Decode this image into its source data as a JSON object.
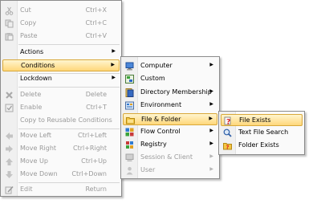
{
  "main_menu": {
    "items": [
      {
        "label": "Cut",
        "shortcut": "Ctrl+X",
        "icon": "cut-icon",
        "enabled": false
      },
      {
        "label": "Copy",
        "shortcut": "Ctrl+C",
        "icon": "copy-icon",
        "enabled": false
      },
      {
        "label": "Paste",
        "shortcut": "Ctrl+V",
        "icon": "paste-icon",
        "enabled": false
      },
      {
        "label": "Actions",
        "submenu": true,
        "enabled": true
      },
      {
        "label": "Conditions",
        "submenu": true,
        "enabled": true,
        "highlighted": true
      },
      {
        "label": "Lockdown",
        "submenu": true,
        "enabled": true
      },
      {
        "label": "Delete",
        "shortcut": "Delete",
        "icon": "delete-icon",
        "enabled": false
      },
      {
        "label": "Enable",
        "shortcut": "Ctrl+T",
        "icon": "enable-icon",
        "enabled": false
      },
      {
        "label": "Copy to Reusable Conditions",
        "enabled": false
      },
      {
        "label": "Move Left",
        "shortcut": "Ctrl+Left",
        "icon": "move-left-icon",
        "enabled": false
      },
      {
        "label": "Move Right",
        "shortcut": "Ctrl+Right",
        "icon": "move-right-icon",
        "enabled": false
      },
      {
        "label": "Move Up",
        "shortcut": "Ctrl+Up",
        "icon": "move-up-icon",
        "enabled": false
      },
      {
        "label": "Move Down",
        "shortcut": "Ctrl+Down",
        "icon": "move-down-icon",
        "enabled": false
      },
      {
        "label": "Edit",
        "shortcut": "Return",
        "icon": "edit-icon",
        "enabled": false
      }
    ]
  },
  "conditions_menu": {
    "items": [
      {
        "label": "Computer",
        "icon": "computer-icon",
        "submenu": true,
        "enabled": true
      },
      {
        "label": "Custom",
        "icon": "custom-icon",
        "submenu": false,
        "enabled": true
      },
      {
        "label": "Directory Membership",
        "icon": "directory-icon",
        "submenu": true,
        "enabled": true
      },
      {
        "label": "Environment",
        "icon": "environment-icon",
        "submenu": true,
        "enabled": true
      },
      {
        "label": "File & Folder",
        "icon": "folder-icon",
        "submenu": true,
        "enabled": true,
        "highlighted": true
      },
      {
        "label": "Flow Control",
        "icon": "flow-control-icon",
        "submenu": true,
        "enabled": true
      },
      {
        "label": "Registry",
        "icon": "registry-icon",
        "submenu": true,
        "enabled": true
      },
      {
        "label": "Session & Client",
        "icon": "session-icon",
        "submenu": true,
        "enabled": false
      },
      {
        "label": "User",
        "icon": "user-icon",
        "submenu": true,
        "enabled": false
      }
    ]
  },
  "file_folder_menu": {
    "items": [
      {
        "label": "File Exists",
        "icon": "file-exists-icon",
        "enabled": true,
        "highlighted": true
      },
      {
        "label": "Text File Search",
        "icon": "text-search-icon",
        "enabled": true
      },
      {
        "label": "Folder Exists",
        "icon": "folder-exists-icon",
        "enabled": true
      }
    ]
  },
  "submenu_arrow": "▶"
}
